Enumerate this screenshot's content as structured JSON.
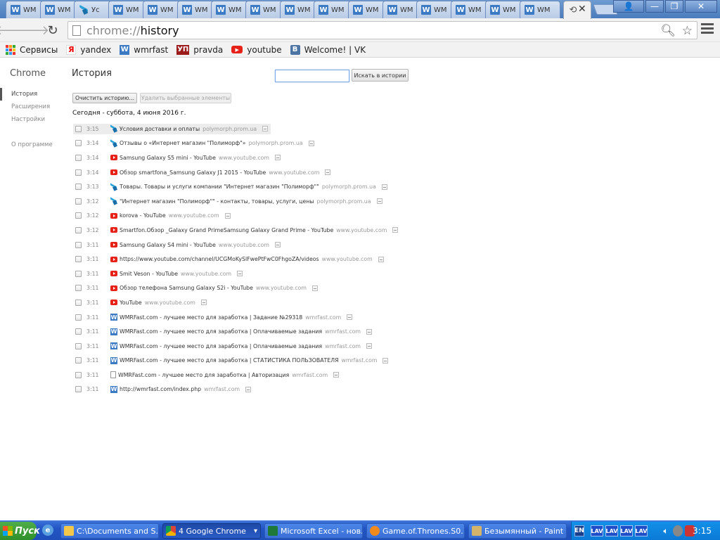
{
  "browser": {
    "tabs": [
      {
        "title": "WM",
        "favicon": "w"
      },
      {
        "title": "WM",
        "favicon": "w"
      },
      {
        "title": "Ус",
        "favicon": "polymorph"
      },
      {
        "title": "WM",
        "favicon": "w"
      },
      {
        "title": "WM",
        "favicon": "w"
      },
      {
        "title": "WM",
        "favicon": "w"
      },
      {
        "title": "WM",
        "favicon": "w"
      },
      {
        "title": "WM",
        "favicon": "w"
      },
      {
        "title": "WM",
        "favicon": "w"
      },
      {
        "title": "WM",
        "favicon": "w"
      },
      {
        "title": "WM",
        "favicon": "w"
      },
      {
        "title": "WM",
        "favicon": "w"
      },
      {
        "title": "WM",
        "favicon": "w"
      },
      {
        "title": "WM",
        "favicon": "w"
      },
      {
        "title": "WM",
        "favicon": "w"
      },
      {
        "title": "WM",
        "favicon": "w"
      },
      {
        "title": "",
        "favicon": "history",
        "active": true
      }
    ],
    "tab_close": "✕",
    "window_buttons": {
      "user": "👤",
      "minimize": "—",
      "restore": "❐",
      "close": "✕"
    },
    "url_scheme": "chrome://",
    "url_path": "history",
    "bookmarks": [
      {
        "label": "Сервисы",
        "icon": "apps-icon"
      },
      {
        "label": "yandex",
        "icon": "yandex-icon",
        "glyph": "Я"
      },
      {
        "label": "wmrfast",
        "icon": "wmrfast-icon",
        "glyph": "W"
      },
      {
        "label": "pravda",
        "icon": "pravda-icon",
        "glyph": "УП"
      },
      {
        "label": "youtube",
        "icon": "youtube-icon",
        "glyph": "▶"
      },
      {
        "label": "Welcome! | VK",
        "icon": "vk-icon",
        "glyph": "B"
      }
    ]
  },
  "page": {
    "brand": "Chrome",
    "nav": [
      {
        "label": "История",
        "selected": true
      },
      {
        "label": "Расширения",
        "selected": false
      },
      {
        "label": "Настройки",
        "selected": false
      },
      {
        "label": "О программе",
        "selected": false
      }
    ],
    "title": "История",
    "search_placeholder": "",
    "search_button": "Искать в истории",
    "clear_button": "Очистить историю...",
    "remove_button": "Удалить выбранные элементы",
    "day_header": "Сегодня - суббота, 4 июня 2016 г.",
    "entries": [
      {
        "time": "3:15",
        "favicon": "polymorph",
        "title": "Условия доставки и оплаты",
        "domain": "polymorph.prom.ua",
        "highlight": true
      },
      {
        "time": "3:14",
        "favicon": "polymorph",
        "title": "Отзывы о «Интернет магазин \"Полиморф\"»",
        "domain": "polymorph.prom.ua"
      },
      {
        "time": "3:14",
        "favicon": "youtube",
        "title": "Samsung Galaxy S5 mini - YouTube",
        "domain": "www.youtube.com"
      },
      {
        "time": "3:14",
        "favicon": "youtube",
        "title": "Обзор smartfona_Samsung Galaxy J1 2015 - YouTube",
        "domain": "www.youtube.com"
      },
      {
        "time": "3:13",
        "favicon": "polymorph",
        "title": "Товары. Товары и услуги компании \"Интернет магазин \"Полиморф\"\"",
        "domain": "polymorph.prom.ua"
      },
      {
        "time": "3:12",
        "favicon": "polymorph",
        "title": "\"Интернет магазин \"Полиморф\"\" - контакты, товары, услуги, цены",
        "domain": "polymorph.prom.ua"
      },
      {
        "time": "3:12",
        "favicon": "youtube",
        "title": "korova - YouTube",
        "domain": "www.youtube.com"
      },
      {
        "time": "3:12",
        "favicon": "youtube",
        "title": "Smartfon.Обзор _Galaxy Grand PrimeSamsung Galaxy Grand Prime - YouTube",
        "domain": "www.youtube.com"
      },
      {
        "time": "3:11",
        "favicon": "youtube",
        "title": "Samsung Galaxy S4 mini - YouTube",
        "domain": "www.youtube.com"
      },
      {
        "time": "3:11",
        "favicon": "youtube",
        "title": "https://www.youtube.com/channel/UCGMoKySlFwePtFwC0FhgoZA/videos",
        "domain": "www.youtube.com"
      },
      {
        "time": "3:11",
        "favicon": "youtube",
        "title": "Smit Veson - YouTube",
        "domain": "www.youtube.com"
      },
      {
        "time": "3:11",
        "favicon": "youtube",
        "title": "Обзор телефона Samsung Galaxy S2i - YouTube",
        "domain": "www.youtube.com"
      },
      {
        "time": "3:11",
        "favicon": "youtube",
        "title": "YouTube",
        "domain": "www.youtube.com"
      },
      {
        "time": "3:11",
        "favicon": "wmrfast",
        "title": "WMRFast.com - лучшее место для заработка | Задание №29318",
        "domain": "wmrfast.com"
      },
      {
        "time": "3:11",
        "favicon": "wmrfast",
        "title": "WMRFast.com - лучшее место для заработка | Оплачиваемые задания",
        "domain": "wmrfast.com"
      },
      {
        "time": "3:11",
        "favicon": "wmrfast",
        "title": "WMRFast.com - лучшее место для заработка | Оплачиваемые задания",
        "domain": "wmrfast.com"
      },
      {
        "time": "3:11",
        "favicon": "wmrfast",
        "title": "WMRFast.com - лучшее место для заработка | СТАТИСТИКА ПОЛЬЗОВАТЕЛЯ",
        "domain": "wmrfast.com"
      },
      {
        "time": "3:11",
        "favicon": "document",
        "title": "WMRFast.com - лучшее место для заработка | Авторизация",
        "domain": "wmrfast.com"
      },
      {
        "time": "3:11",
        "favicon": "wmrfast",
        "title": "http://wmrfast.com/index.php",
        "domain": "wmrfast.com"
      }
    ]
  },
  "taskbar": {
    "start_label": "Пуск",
    "tasks": [
      {
        "label": "C:\\Documents and S...",
        "icon": "folder",
        "active": false
      },
      {
        "label": "4 Google Chrome",
        "icon": "chrome",
        "active": true
      },
      {
        "label": "Microsoft Excel - нов...",
        "icon": "excel",
        "active": false
      },
      {
        "label": "Game.of.Thrones.S0...",
        "icon": "media",
        "active": false
      },
      {
        "label": "Безымянный - Paint",
        "icon": "paint",
        "active": false
      }
    ],
    "tray": {
      "lang": "EN",
      "lav": [
        "LAV",
        "LAV",
        "LAV",
        "LAV"
      ],
      "clock": "3:15"
    }
  }
}
